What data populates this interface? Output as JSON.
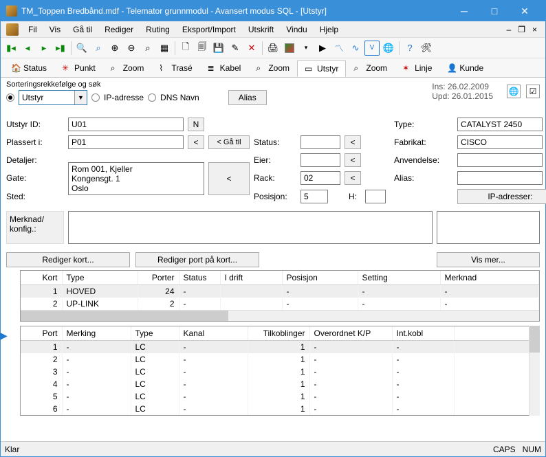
{
  "window": {
    "title": "TM_Toppen Bredbånd.mdf - Telemator grunnmodul - Avansert modus SQL - [Utstyr]"
  },
  "menu": [
    "Fil",
    "Vis",
    "Gå til",
    "Rediger",
    "Ruting",
    "Eksport/Import",
    "Utskrift",
    "Vindu",
    "Hjelp"
  ],
  "tabs": [
    {
      "label": "Status"
    },
    {
      "label": "Punkt"
    },
    {
      "label": "Zoom"
    },
    {
      "label": "Trasé"
    },
    {
      "label": "Kabel"
    },
    {
      "label": "Zoom"
    },
    {
      "label": "Utstyr",
      "active": true
    },
    {
      "label": "Zoom"
    },
    {
      "label": "Linje"
    },
    {
      "label": "Kunde"
    }
  ],
  "sort": {
    "legend": "Sorteringsrekkefølge og søk",
    "value": "Utstyr",
    "options": [
      "Utstyr",
      "IP-adresse",
      "DNS Navn"
    ],
    "aliasBtn": "Alias"
  },
  "meta": {
    "ins": "Ins: 26.02.2009",
    "upd": "Upd: 26.01.2015"
  },
  "labels": {
    "utstyrId": "Utstyr ID:",
    "plassert": "Plassert i:",
    "detaljer": "Detaljer:",
    "gate": "Gate:",
    "sted": "Sted:",
    "status": "Status:",
    "eier": "Eier:",
    "rack": "Rack:",
    "posisjon": "Posisjon:",
    "h": "H:",
    "type": "Type:",
    "fabrikat": "Fabrikat:",
    "anvendelse": "Anvendelse:",
    "alias": "Alias:",
    "merknad": "Merknad/\nkonfig.:",
    "goto": "< Gå til",
    "ip": "IP-adresser:",
    "redKort": "Rediger kort...",
    "redPort": "Rediger port på kort...",
    "visMer": "Vis mer...",
    "n": "N",
    "lt": "<"
  },
  "fields": {
    "utstyrId": "U01",
    "plassert": "P01",
    "details": "Rom 001, Kjeller\nKongensgt. 1\nOslo",
    "status": "",
    "eier": "",
    "rack": "02",
    "posisjon": "5",
    "h": "",
    "type": "CATALYST 2450",
    "fabrikat": "CISCO",
    "anvendelse": "",
    "alias": ""
  },
  "grid1": {
    "headers": [
      "Kort",
      "Type",
      "Porter",
      "Status",
      "I drift",
      "Posisjon",
      "Setting",
      "Merknad"
    ],
    "rows": [
      {
        "kort": "1",
        "type": "HOVED",
        "porter": "24",
        "status": "-",
        "idrift": "",
        "pos": "-",
        "setting": "-",
        "merk": "-",
        "hl": true
      },
      {
        "kort": "2",
        "type": "UP-LINK",
        "porter": "2",
        "status": "-",
        "idrift": "",
        "pos": "-",
        "setting": "-",
        "merk": "-"
      }
    ]
  },
  "grid2": {
    "headers": [
      "Port",
      "Merking",
      "Type",
      "Kanal",
      "Tilkoblinger",
      "Overordnet K/P",
      "Int.kobl"
    ],
    "rows": [
      {
        "port": "1",
        "merk": "-",
        "type": "LC",
        "kanal": "-",
        "tilk": "1",
        "over": "-",
        "int": "-",
        "hl": true
      },
      {
        "port": "2",
        "merk": "-",
        "type": "LC",
        "kanal": "-",
        "tilk": "1",
        "over": "-",
        "int": "-"
      },
      {
        "port": "3",
        "merk": "-",
        "type": "LC",
        "kanal": "-",
        "tilk": "1",
        "over": "-",
        "int": "-"
      },
      {
        "port": "4",
        "merk": "-",
        "type": "LC",
        "kanal": "-",
        "tilk": "1",
        "over": "-",
        "int": "-"
      },
      {
        "port": "5",
        "merk": "-",
        "type": "LC",
        "kanal": "-",
        "tilk": "1",
        "over": "-",
        "int": "-"
      },
      {
        "port": "6",
        "merk": "-",
        "type": "LC",
        "kanal": "-",
        "tilk": "1",
        "over": "-",
        "int": "-"
      }
    ]
  },
  "statusbar": {
    "left": "Klar",
    "caps": "CAPS",
    "num": "NUM"
  }
}
